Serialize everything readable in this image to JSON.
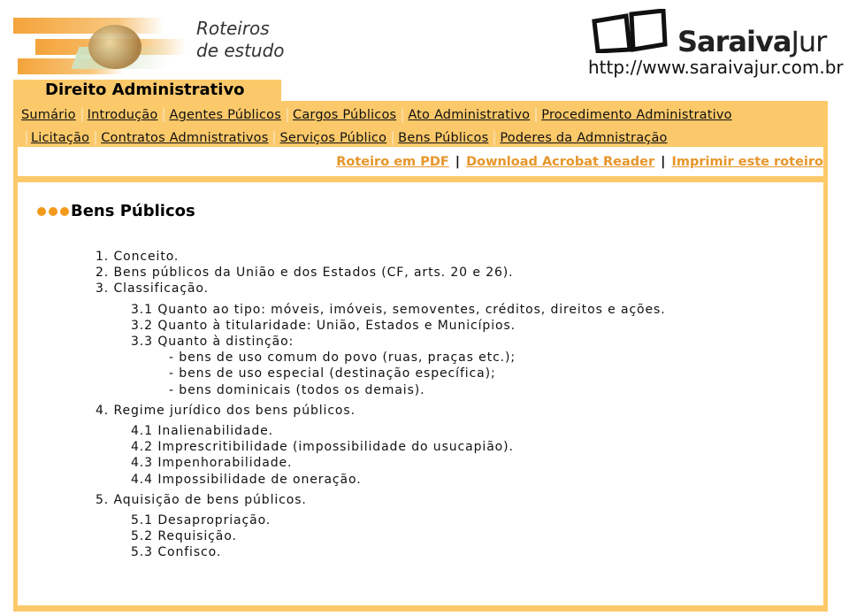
{
  "header": {
    "logo_text_line1": "Roteiros",
    "logo_text_line2": "de estudo",
    "brand_name_bold": "Saraiva",
    "brand_name_regular": "Jur",
    "site_url": "http://www.saraivajur.com.br",
    "section_title": "Direito Administrativo"
  },
  "nav": {
    "row1": [
      "Sumário",
      "Introdução",
      "Agentes Públicos",
      "Cargos Públicos",
      "Ato Administrativo",
      "Procedimento Administrativo"
    ],
    "row2": [
      "Licitação",
      "Contratos Admnistrativos",
      "Serviços Público",
      "Bens Públicos",
      "Poderes da Admnistração"
    ]
  },
  "tools": {
    "pdf": "Roteiro em PDF",
    "separator": "|",
    "acrobat": "Download Acrobat Reader",
    "print": "Imprimir este roteiro"
  },
  "page": {
    "title": "Bens Públicos",
    "outline": [
      {
        "level": 1,
        "text": "1. Conceito."
      },
      {
        "level": 1,
        "text": "2. Bens públicos da União e dos Estados (CF, arts. 20 e 26)."
      },
      {
        "level": 1,
        "text": "3. Classificação."
      },
      {
        "level": "gap"
      },
      {
        "level": 2,
        "text": "3.1 Quanto ao tipo: móveis, imóveis, semoventes, créditos, direitos e ações."
      },
      {
        "level": 2,
        "text": "3.2 Quanto à titularidade: União, Estados e Municípios."
      },
      {
        "level": 2,
        "text": "3.3 Quanto à distinção:"
      },
      {
        "level": 3,
        "text": "- bens de uso comum do povo (ruas, praças etc.);"
      },
      {
        "level": 3,
        "text": "- bens de uso especial (destinação específica);"
      },
      {
        "level": 3,
        "text": "- bens dominicais (todos os demais)."
      },
      {
        "level": "gap"
      },
      {
        "level": 1,
        "text": "4. Regime jurídico dos bens públicos."
      },
      {
        "level": "gap"
      },
      {
        "level": 2,
        "text": "4.1 Inalienabilidade."
      },
      {
        "level": 2,
        "text": "4.2 Imprescritibilidade (impossibilidade do usucapião)."
      },
      {
        "level": 2,
        "text": "4.3 Impenhorabilidade."
      },
      {
        "level": 2,
        "text": "4.4 Impossibilidade de oneração."
      },
      {
        "level": "gap"
      },
      {
        "level": 1,
        "text": "5. Aquisição de bens públicos."
      },
      {
        "level": "gap"
      },
      {
        "level": 2,
        "text": "5.1 Desapropriação."
      },
      {
        "level": 2,
        "text": "5.2 Requisição."
      },
      {
        "level": 2,
        "text": "5.3 Confisco."
      }
    ]
  },
  "colors": {
    "panel": "#fcc96a",
    "link_accent": "#e6962a",
    "bullet": "#f39a1c"
  }
}
